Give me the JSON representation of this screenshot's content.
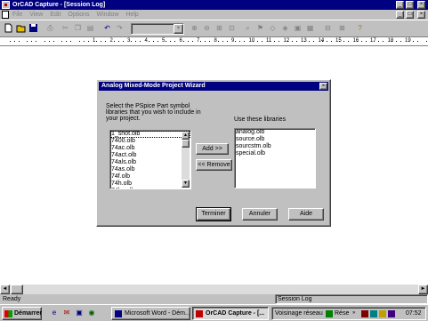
{
  "window": {
    "title": "OrCAD Capture - [Session Log]",
    "controls": [
      "_",
      "□",
      "×"
    ]
  },
  "menubar": {
    "items": [
      "File",
      "View",
      "Edit",
      "Options",
      "Window",
      "Help"
    ],
    "mdi_controls": [
      "_",
      "□",
      "×"
    ]
  },
  "toolbar": {
    "buttons": [
      "new",
      "open",
      "save",
      "print",
      "cut",
      "copy",
      "paste",
      "undo",
      "redo",
      "zoom-in",
      "zoom-out",
      "zoom-area",
      "zoom-all",
      "find",
      "bookmark",
      "project",
      "help"
    ]
  },
  "ruler": {
    "numbers": [
      "1",
      "2",
      "3",
      "4",
      "5",
      "6",
      "7",
      "8",
      "9",
      "10",
      "11",
      "12",
      "13",
      "14",
      "15",
      "16",
      "17",
      "18",
      "19"
    ]
  },
  "dialog": {
    "title": "Analog Mixed-Mode Project Wizard",
    "close": "×",
    "instruction": "Select the PSpice Part symbol libraries that you wish to include in your project.",
    "use_label": "Use these libraries",
    "available_libraries": [
      "1_shot.olb",
      "7400.olb",
      "74ac.olb",
      "74act.olb",
      "74als.olb",
      "74as.olb",
      "74f.olb",
      "74h.olb",
      "74hc.olb"
    ],
    "selected_available": "1_shot.olb",
    "used_libraries": [
      "analog.olb",
      "source.olb",
      "sourcstm.olb",
      "special.olb"
    ],
    "add_button": "Add >>",
    "remove_button": "<< Remove",
    "finish_button": "Terminer",
    "cancel_button": "Annuler",
    "help_button": "Aide"
  },
  "statusbar": {
    "left": "Ready",
    "right": "Session Log"
  },
  "taskbar": {
    "start": "Démarrer",
    "tasks": [
      {
        "label": "Microsoft Word - Dém...",
        "active": false
      },
      {
        "label": "OrCAD Capture - [...",
        "active": true
      }
    ],
    "network": "Voisinage réseau",
    "tray_item": "Rése",
    "clock": "07:52"
  }
}
